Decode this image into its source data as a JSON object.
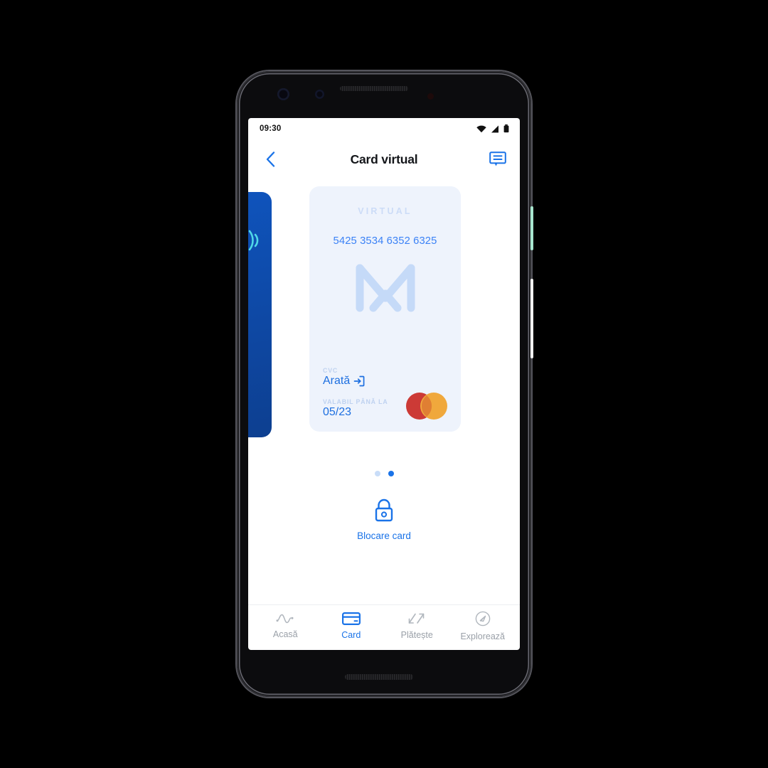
{
  "device": {
    "name": "pixel-phone"
  },
  "status_bar": {
    "time": "09:30",
    "icons": [
      "wifi-icon",
      "cellular-signal-icon",
      "battery-icon"
    ]
  },
  "header": {
    "back_icon": "chevron-left-icon",
    "title": "Card virtual",
    "chat_icon": "chat-bubble-icon"
  },
  "carousel": {
    "previous_card": {
      "name": "physical-card",
      "color": "#0e4aa8",
      "nfc_icon": "contactless-icon",
      "brand_icon": "mastercard-icon"
    },
    "active_card": {
      "type_label": "VIRTUAL",
      "number": "5425 3534 6352 6325",
      "brand_logo": "monzo-m-logo",
      "cvc": {
        "label": "CVC",
        "value": "Arată",
        "action_icon": "reveal-icon"
      },
      "expiry": {
        "label": "VALABIL PÂNĂ LA",
        "value": "05/23"
      },
      "brand_icon": "mastercard-icon",
      "background": "#eef3fc",
      "accent": "#1d6fe0"
    },
    "pagination": {
      "total": 2,
      "active_index": 1
    }
  },
  "actions": {
    "lock_card": {
      "icon": "lock-icon",
      "label": "Blocare card"
    }
  },
  "bottom_nav": {
    "active_index": 1,
    "items": [
      {
        "label": "Acasă",
        "icon": "activity-wave-icon"
      },
      {
        "label": "Card",
        "icon": "credit-card-icon"
      },
      {
        "label": "Plătește",
        "icon": "send-receive-arrows-icon"
      },
      {
        "label": "Explorează",
        "icon": "compass-icon"
      }
    ]
  },
  "colors": {
    "accent": "#1a73e8",
    "card_bg": "#eef3fc",
    "dark_card": "#0e4aa8"
  }
}
